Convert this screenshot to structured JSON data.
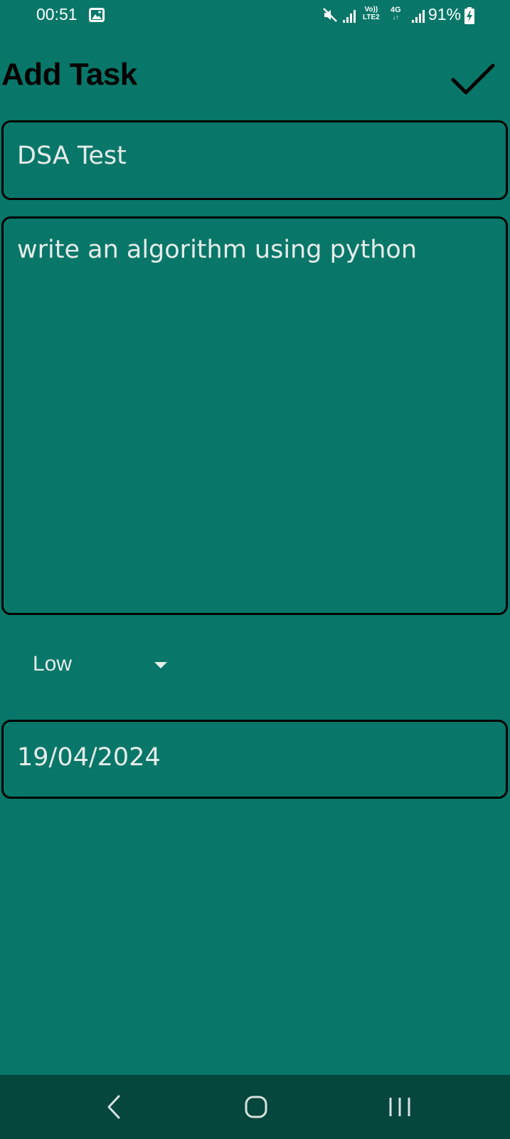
{
  "status_bar": {
    "time": "00:51",
    "volte_line1": "Vo))",
    "volte_line2": "LTE2",
    "network_type": "4G",
    "battery_percent": "91%",
    "icons": [
      "gallery-icon",
      "mute-icon",
      "signal-icon",
      "signal-icon",
      "battery-charging-icon"
    ]
  },
  "header": {
    "title": "Add Task",
    "save_icon": "check-icon"
  },
  "form": {
    "title_value": "DSA Test",
    "description_value": "write an algorithm using python",
    "priority_selected": "Low",
    "date_value": "19/04/2024"
  },
  "nav_bar": {
    "icons": [
      "back-icon",
      "home-icon",
      "recents-icon"
    ]
  },
  "colors": {
    "background": "#087769",
    "nav_background": "#05463d",
    "field_border": "#000000",
    "text_light": "#e6ecea"
  }
}
